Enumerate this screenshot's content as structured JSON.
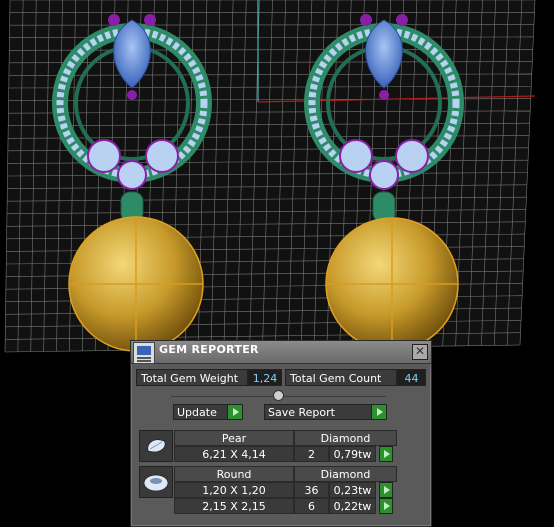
{
  "panel": {
    "title": "GEM REPORTER",
    "close_glyph": "✕",
    "total_gem_weight_label": "Total Gem Weight",
    "total_gem_weight_value": "1,24",
    "total_gem_count_label": "Total Gem Count",
    "total_gem_count_value": "44",
    "update_label": "Update",
    "save_report_label": "Save Report",
    "gems": [
      {
        "shape": "Pear",
        "material": "Diamond",
        "icon": "pear-gem-icon",
        "rows": [
          {
            "size": "6,21 X 4,14",
            "count": "2",
            "weight": "0,79tw"
          }
        ]
      },
      {
        "shape": "Round",
        "material": "Diamond",
        "icon": "round-gem-icon",
        "rows": [
          {
            "size": "1,20 X 1,20",
            "count": "36",
            "weight": "0,23tw"
          },
          {
            "size": "2,15 X 2,15",
            "count": "6",
            "weight": "0,22tw"
          }
        ]
      }
    ]
  },
  "colors": {
    "background": "#000000",
    "grid": "#8a8a8a",
    "metal": "#2e8b67",
    "gold": "#c79a2a",
    "pave": "#b9d2f2",
    "prong": "#8a1ea8",
    "accent_value": "#7fd0ff"
  }
}
